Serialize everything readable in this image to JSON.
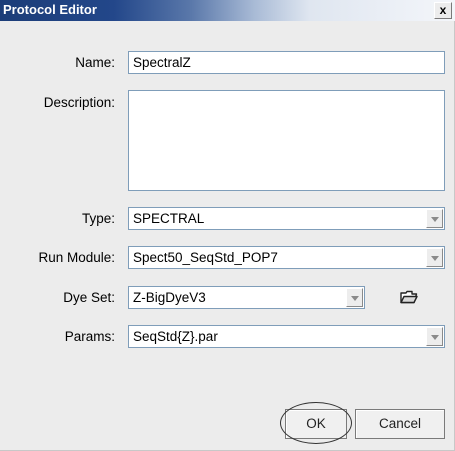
{
  "window": {
    "title": "Protocol Editor",
    "close_label": "x"
  },
  "form": {
    "name_label": "Name:",
    "name_value": "SpectralZ",
    "description_label": "Description:",
    "description_value": "",
    "type_label": "Type:",
    "type_value": "SPECTRAL",
    "run_module_label": "Run Module:",
    "run_module_value": "Spect50_SeqStd_POP7",
    "dye_set_label": "Dye Set:",
    "dye_set_value": "Z-BigDyeV3",
    "params_label": "Params:",
    "params_value": "SeqStd{Z}.par"
  },
  "buttons": {
    "ok_label": "OK",
    "cancel_label": "Cancel"
  },
  "icons": {
    "dye_set_browse": "folder-open-icon"
  }
}
